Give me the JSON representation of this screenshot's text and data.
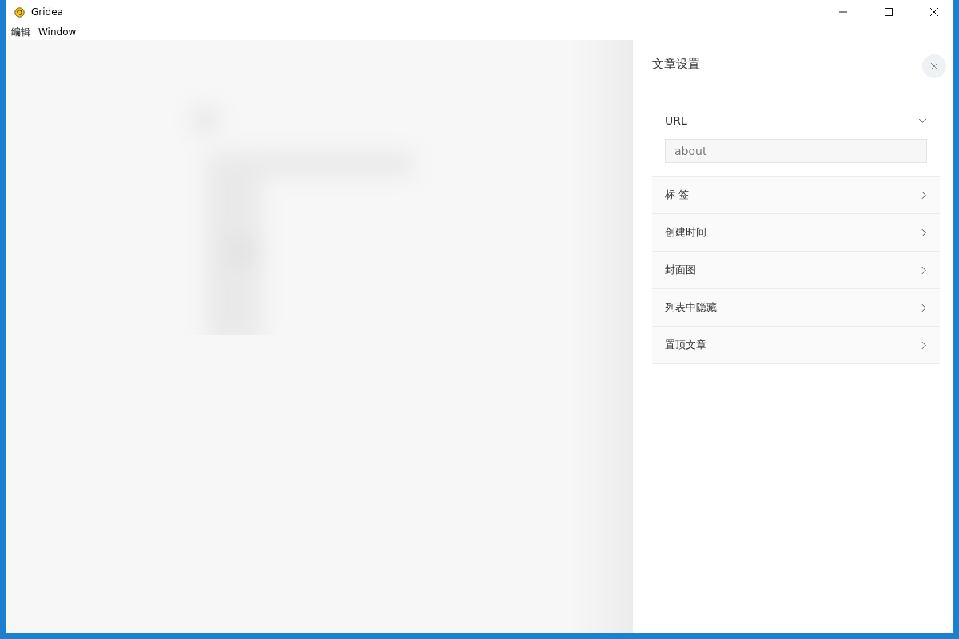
{
  "window": {
    "title": "Gridea"
  },
  "menu": [
    "编辑",
    "Window"
  ],
  "drawer": {
    "title": "文章设置",
    "sections": [
      {
        "label": "URL",
        "expanded": true,
        "value": "about"
      },
      {
        "label": "标 签",
        "expanded": false
      },
      {
        "label": "创建时间",
        "expanded": false
      },
      {
        "label": "封面图",
        "expanded": false
      },
      {
        "label": "列表中隐藏",
        "expanded": false
      },
      {
        "label": "置顶文章",
        "expanded": false
      }
    ]
  }
}
